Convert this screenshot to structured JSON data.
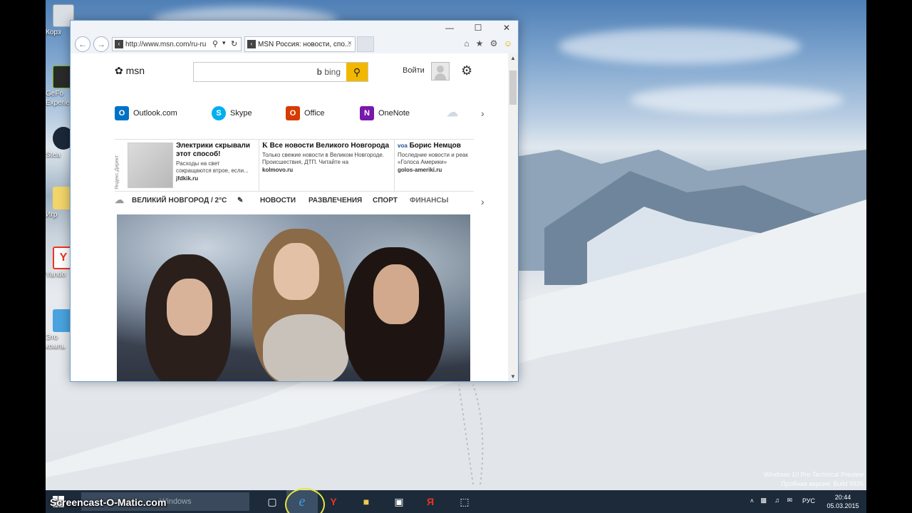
{
  "desktop": {
    "icons": [
      {
        "label": "Корз"
      },
      {
        "label": "GeFo"
      },
      {
        "label": "Experie"
      },
      {
        "label": "Stea"
      },
      {
        "label": "Игр"
      },
      {
        "label": "Yando"
      },
      {
        "label": "Это"
      },
      {
        "label": "компь"
      }
    ],
    "watermark_line1": "Windows 10 Pro Technical Preview",
    "watermark_line2": "Пробная версия. Build 9926"
  },
  "browser": {
    "address": "http://www.msn.com/ru-ru",
    "tab_title": "MSN Россия: новости, спо...",
    "tab_close": "×",
    "controls": {
      "minimize": "—",
      "maximize": "☐",
      "close": "✕"
    }
  },
  "page": {
    "logo": "msn",
    "search_placeholder": "",
    "search_brand": "bing",
    "signin": "Войти",
    "apps": [
      {
        "label": "Outlook.com",
        "color": "#0072c6",
        "glyph": "O"
      },
      {
        "label": "Skype",
        "color": "#00aff0",
        "glyph": "S"
      },
      {
        "label": "Office",
        "color": "#d83b01",
        "glyph": "O"
      },
      {
        "label": "OneNote",
        "color": "#7719aa",
        "glyph": "N"
      }
    ],
    "ads": {
      "label": "Яндекс.Директ",
      "items": [
        {
          "title": "Электрики скрывали этот способ!",
          "text": "Расходы на свет сокращаются втрое, если...",
          "source": "jfdkik.ru"
        },
        {
          "title": "Все новости Великого Новгорода",
          "text": "Только свежие новости в Великом Новгороде. Происшествия, ДТП. Читайте на",
          "source": "kolmovo.ru"
        },
        {
          "title": "Борис Немцов",
          "text": "Последние новости и реак «Голоса Америки»",
          "source": "golos-ameriki.ru"
        }
      ]
    },
    "nav": {
      "weather": "ВЕЛИКИЙ НОВГОРОД / 2°C",
      "items": [
        "НОВОСТИ",
        "РАЗВЛЕЧЕНИЯ",
        "СПОРТ",
        "ФИНАНСЫ"
      ]
    }
  },
  "taskbar": {
    "search_placeholder": "Windows",
    "brand": "Screencast-O-Matic.com",
    "tray_lang": "РУС",
    "time": "20:44",
    "date": "05.03.2015"
  }
}
